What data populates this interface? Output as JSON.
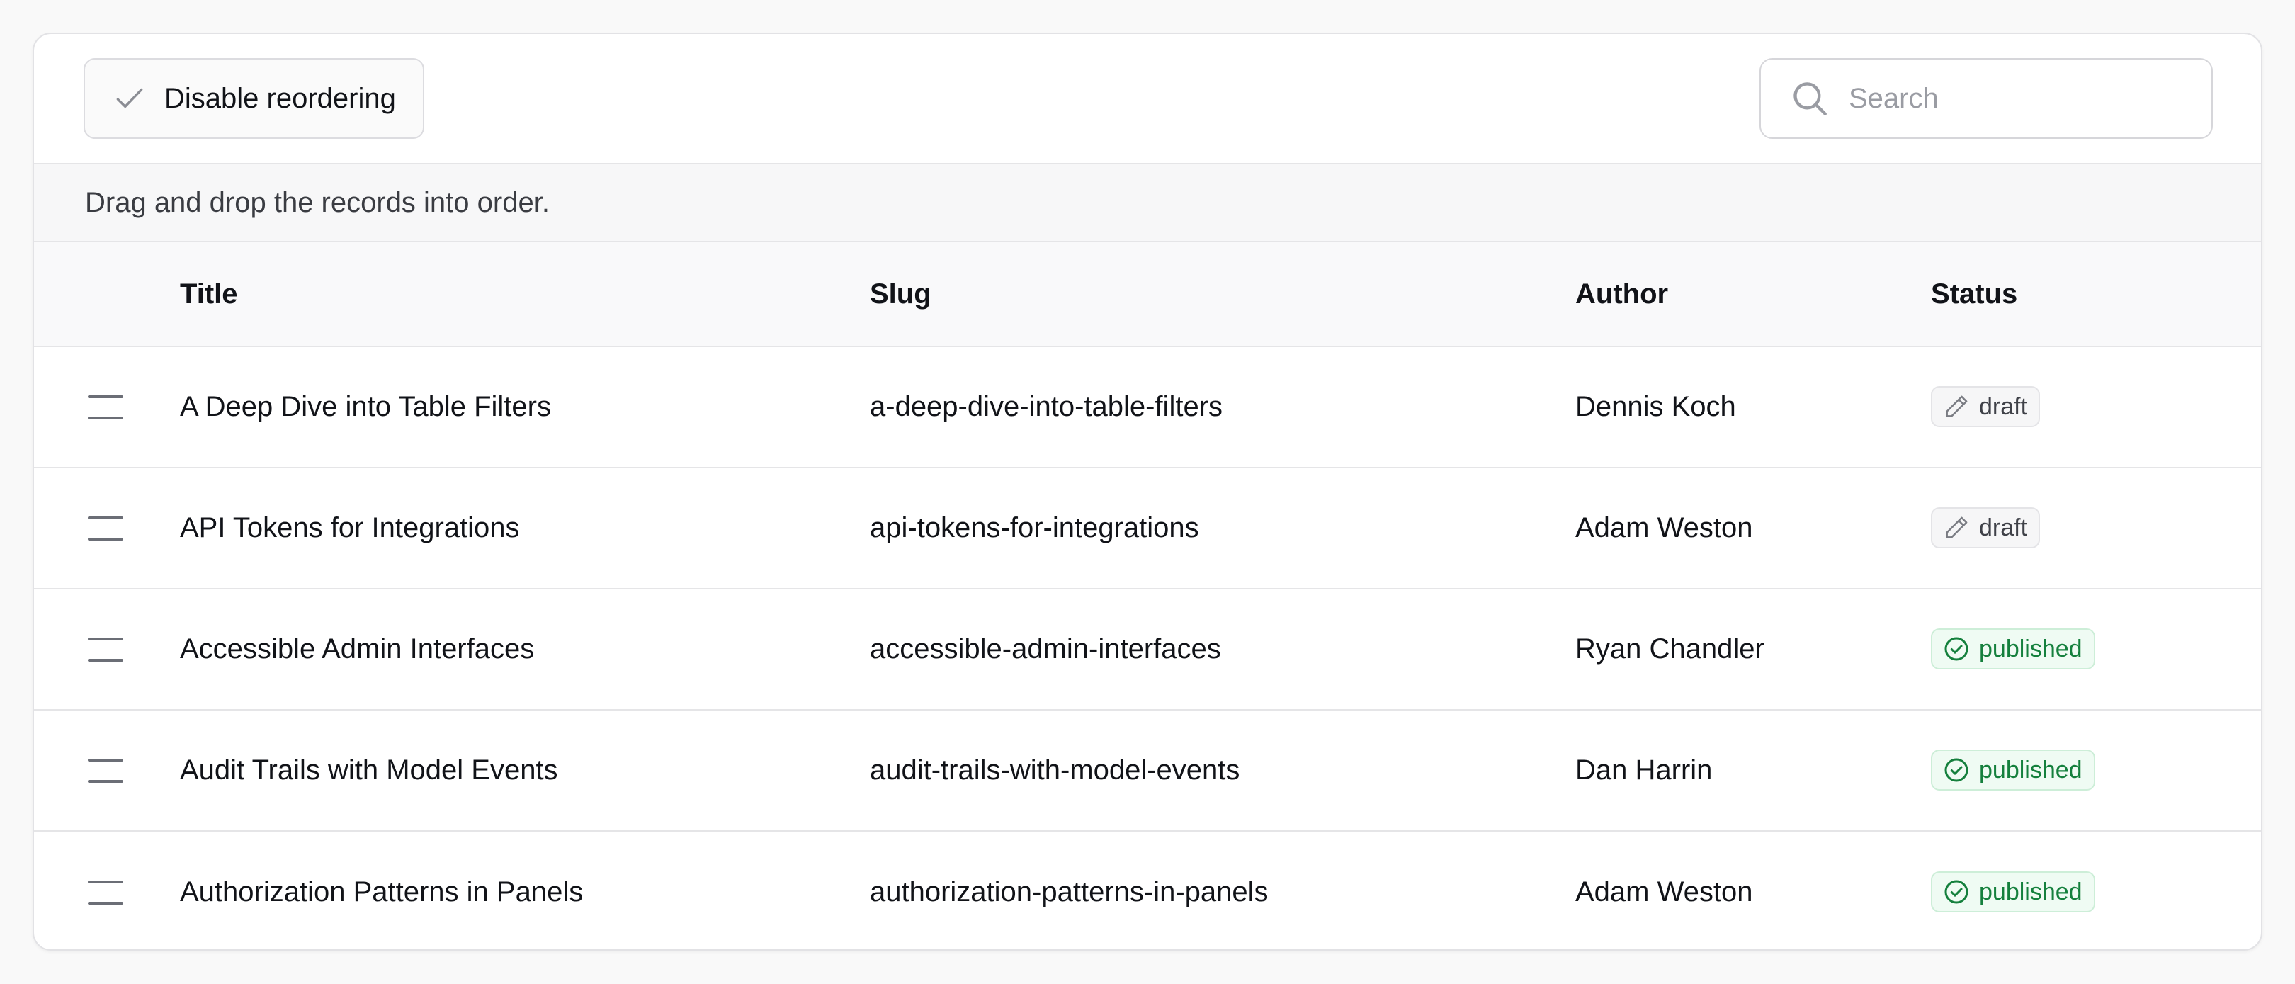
{
  "toolbar": {
    "reorder_button_label": "Disable reordering",
    "search_placeholder": "Search",
    "search_value": ""
  },
  "hint_text": "Drag and drop the records into order.",
  "table": {
    "columns": [
      "Title",
      "Slug",
      "Author",
      "Status"
    ],
    "rows": [
      {
        "title": "A Deep Dive into Table Filters",
        "slug": "a-deep-dive-into-table-filters",
        "author": "Dennis Koch",
        "status": "draft",
        "status_icon": "pencil-icon"
      },
      {
        "title": "API Tokens for Integrations",
        "slug": "api-tokens-for-integrations",
        "author": "Adam Weston",
        "status": "draft",
        "status_icon": "pencil-icon"
      },
      {
        "title": "Accessible Admin Interfaces",
        "slug": "accessible-admin-interfaces",
        "author": "Ryan Chandler",
        "status": "published",
        "status_icon": "check-circle-icon"
      },
      {
        "title": "Audit Trails with Model Events",
        "slug": "audit-trails-with-model-events",
        "author": "Dan Harrin",
        "status": "published",
        "status_icon": "check-circle-icon"
      },
      {
        "title": "Authorization Patterns in Panels",
        "slug": "authorization-patterns-in-panels",
        "author": "Adam Weston",
        "status": "published",
        "status_icon": "check-circle-icon"
      }
    ]
  },
  "colors": {
    "published": "#15803d",
    "published_bg": "#effbf3",
    "draft": "#3f4148",
    "draft_bg": "#f6f6f7"
  }
}
